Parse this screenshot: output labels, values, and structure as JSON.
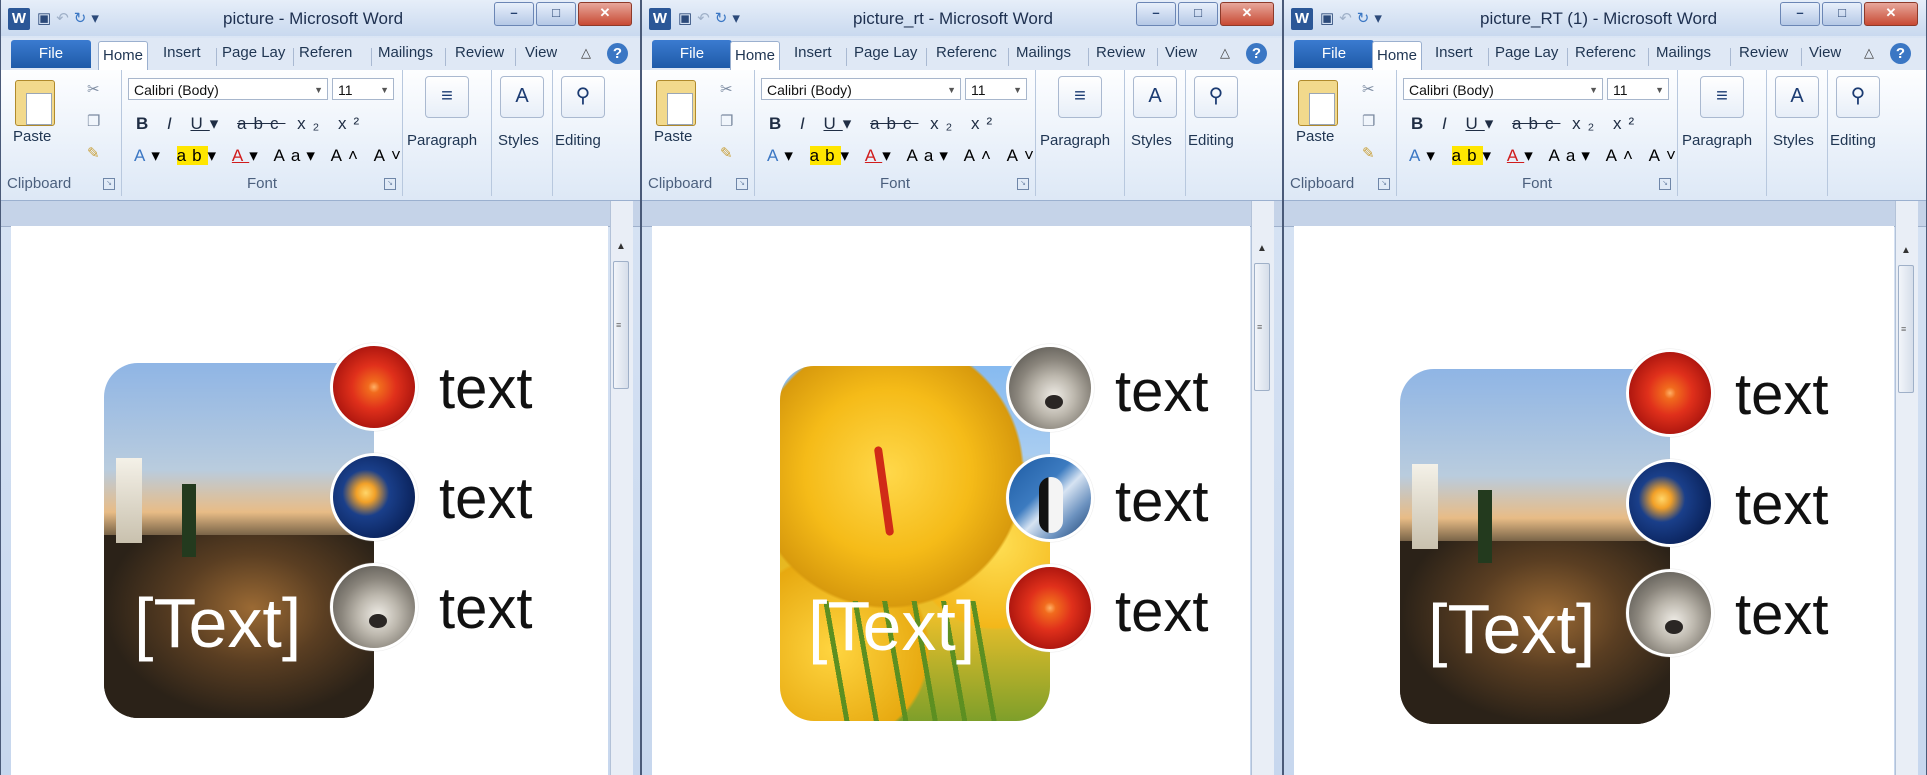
{
  "windows": [
    {
      "title": "picture - Microsoft Word",
      "picture_text": "[Text]",
      "photo": "evening-landscape",
      "bullets": [
        {
          "image": "flower",
          "label": "text"
        },
        {
          "image": "jellyfish",
          "label": "text"
        },
        {
          "image": "koala",
          "label": "text"
        }
      ],
      "tabs": [
        "Home",
        "Insert",
        "Page Lay",
        "Referen",
        "Mailings",
        "Review",
        "View"
      ]
    },
    {
      "title": "picture_rt - Microsoft Word",
      "picture_text": "[Text]",
      "photo": "tulips",
      "bullets": [
        {
          "image": "koala",
          "label": "text"
        },
        {
          "image": "penguins",
          "label": "text"
        },
        {
          "image": "flower",
          "label": "text"
        }
      ],
      "tabs": [
        "Home",
        "Insert",
        "Page Lay",
        "Referenc",
        "Mailings",
        "Review",
        "View"
      ]
    },
    {
      "title": "picture_RT (1) - Microsoft Word",
      "picture_text": "[Text]",
      "photo": "evening-landscape",
      "bullets": [
        {
          "image": "flower",
          "label": "text"
        },
        {
          "image": "jellyfish",
          "label": "text"
        },
        {
          "image": "koala",
          "label": "text"
        }
      ],
      "tabs": [
        "Home",
        "Insert",
        "Page Lay",
        "Referenc",
        "Mailings",
        "Review",
        "View"
      ]
    }
  ],
  "ribbon": {
    "file_tab": "File",
    "paste": "Paste",
    "clipboard": "Clipboard",
    "font_name": "Calibri (Body)",
    "font_size": "11",
    "font_group": "Font",
    "paragraph": "Paragraph",
    "styles": "Styles",
    "editing": "Editing"
  },
  "icons": {
    "app": "W",
    "help": "?",
    "minimize": "–",
    "maximize": "□",
    "close": "✕",
    "ribbon_collapse": "△",
    "scroll_up": "▲"
  }
}
